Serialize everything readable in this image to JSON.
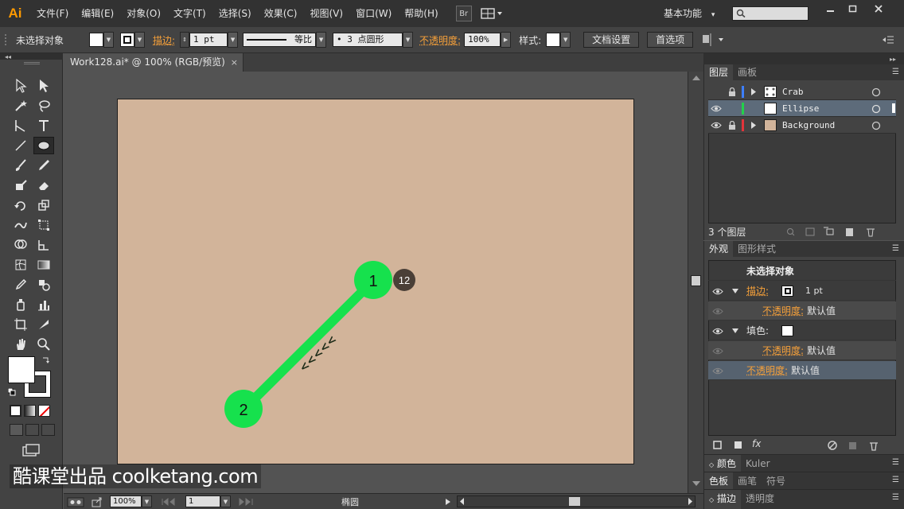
{
  "app": {
    "logo": "Ai"
  },
  "menu": [
    "文件(F)",
    "编辑(E)",
    "对象(O)",
    "文字(T)",
    "选择(S)",
    "效果(C)",
    "视图(V)",
    "窗口(W)",
    "帮助(H)"
  ],
  "menubar": {
    "bridge_label": "Br",
    "workspace": "基本功能",
    "workspace_arrow": "▾"
  },
  "control_bar": {
    "selection_status": "未选择对象",
    "stroke_label": "描边:",
    "stroke_weight": "1 pt",
    "brush_profile": "等比",
    "brush_definition": "• 3 点圆形",
    "opacity_label": "不透明度:",
    "opacity_value": "100%",
    "style_label": "样式:",
    "doc_settings_button": "文档设置",
    "preferences_button": "首选项"
  },
  "document": {
    "tab_title": "Work128.ai* @ 100% (RGB/预览)",
    "close_glyph": "×"
  },
  "canvas": {
    "artboard_color": "#d2b49a",
    "line_color": "#16e14d",
    "anchor_1_label": "1",
    "anchor_2_label": "2",
    "step_badge": "12",
    "direction_marks": "<<<<<"
  },
  "watermark": "酷课堂出品 coolketang.com",
  "status_bar": {
    "zoom": "100%",
    "artboard_number": "1",
    "current_tool": "椭圆"
  },
  "layers_panel": {
    "tabs": [
      "图层",
      "画板"
    ],
    "layers": [
      {
        "name": "Crab",
        "color": "#3d7fff",
        "visible": false,
        "locked": true
      },
      {
        "name": "Ellipse",
        "color": "#23d14a",
        "visible": true,
        "locked": false
      },
      {
        "name": "Background",
        "color": "#e2343a",
        "visible": true,
        "locked": true
      }
    ],
    "footer_count": "3 个图层"
  },
  "appearance_panel": {
    "tabs": [
      "外观",
      "图形样式"
    ],
    "header": "未选择对象",
    "stroke_label": "描边:",
    "stroke_value": "1 pt",
    "opacity_label": "不透明度:",
    "opacity_default": "默认值",
    "fill_label": "填色:",
    "fx_label": "fx"
  },
  "collapsed_panels": {
    "color": [
      "颜色",
      "Kuler"
    ],
    "swatches": [
      "色板",
      "画笔",
      "符号"
    ],
    "stroke": [
      "描边",
      "透明度"
    ]
  },
  "colors": {
    "accent_orange": "#f7a13a",
    "chrome_dark": "#323232",
    "panel_gray": "#434343"
  }
}
